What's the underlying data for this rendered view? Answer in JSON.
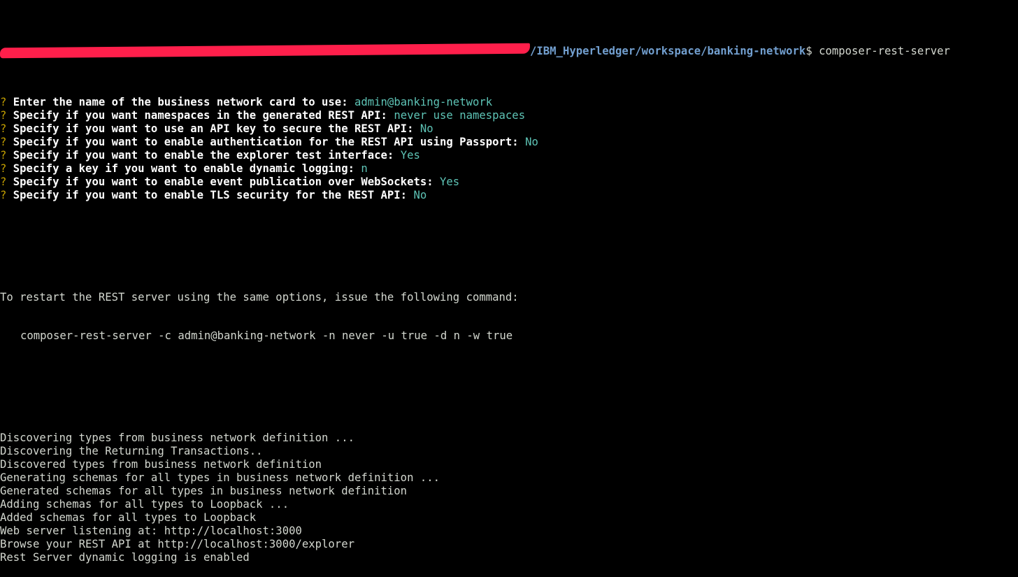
{
  "colors": {
    "background": "#000000",
    "default_text": "#d3d7cf",
    "question_mark": "#c4a000",
    "question_text": "#ffffff",
    "answer": "#5ec4b6",
    "path": "#729fcf",
    "redaction": "#ff1f4b"
  },
  "prompt": {
    "path": "/IBM_Hyperledger/workspace/banking-network",
    "symbol": "$",
    "command": "composer-rest-server"
  },
  "questions": [
    {
      "mark": "?",
      "text": "Enter the name of the business network card to use:",
      "answer": "admin@banking-network"
    },
    {
      "mark": "?",
      "text": "Specify if you want namespaces in the generated REST API:",
      "answer": "never use namespaces"
    },
    {
      "mark": "?",
      "text": "Specify if you want to use an API key to secure the REST API:",
      "answer": "No"
    },
    {
      "mark": "?",
      "text": "Specify if you want to enable authentication for the REST API using Passport:",
      "answer": "No"
    },
    {
      "mark": "?",
      "text": "Specify if you want to enable the explorer test interface:",
      "answer": "Yes"
    },
    {
      "mark": "?",
      "text": "Specify a key if you want to enable dynamic logging:",
      "answer": "n"
    },
    {
      "mark": "?",
      "text": "Specify if you want to enable event publication over WebSockets:",
      "answer": "Yes"
    },
    {
      "mark": "?",
      "text": "Specify if you want to enable TLS security for the REST API:",
      "answer": "No"
    }
  ],
  "restart": {
    "message": "To restart the REST server using the same options, issue the following command:",
    "command": "composer-rest-server -c admin@banking-network -n never -u true -d n -w true"
  },
  "log_lines": [
    "Discovering types from business network definition ...",
    "Discovering the Returning Transactions..",
    "Discovered types from business network definition",
    "Generating schemas for all types in business network definition ...",
    "Generated schemas for all types in business network definition",
    "Adding schemas for all types to Loopback ...",
    "Added schemas for all types to Loopback",
    "Web server listening at: http://localhost:3000",
    "Browse your REST API at http://localhost:3000/explorer",
    "Rest Server dynamic logging is enabled"
  ]
}
